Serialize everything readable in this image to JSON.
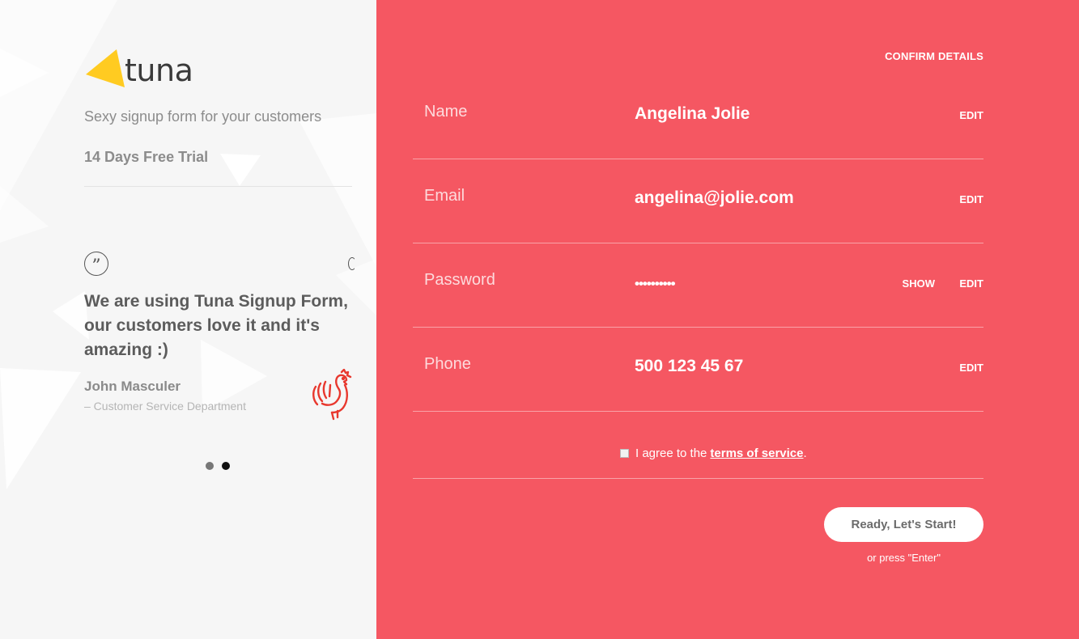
{
  "brand": {
    "logo_text": "tuna",
    "accent_color": "#ffcb21",
    "panel_color": "#f55762"
  },
  "intro": {
    "tagline": "Sexy signup form for your customers",
    "trial": "14 Days Free Trial"
  },
  "testimonial": {
    "quote_icon": "quote-icon",
    "text": "We are using Tuna Signup Form, our customers love it and it's amazing :)",
    "author": "John Masculer",
    "department": "– Customer Service Department",
    "logo_icon": "rooster-icon",
    "dots": [
      {
        "active": false
      },
      {
        "active": true
      }
    ]
  },
  "form": {
    "heading": "CONFIRM DETAILS",
    "fields": [
      {
        "label": "Name",
        "value": "Angelina Jolie",
        "edit": "EDIT"
      },
      {
        "label": "Email",
        "value": "angelina@jolie.com",
        "edit": "EDIT"
      },
      {
        "label": "Password",
        "value": "••••••••••",
        "show": "SHOW",
        "edit": "EDIT"
      },
      {
        "label": "Phone",
        "value": "500 123 45 67",
        "edit": "EDIT"
      }
    ],
    "agree_text": "I agree to the",
    "terms_link": "terms of service",
    "agree_suffix": ".",
    "agree_checked": false,
    "submit_label": "Ready, Let's Start!",
    "hint": "or press \"Enter\""
  }
}
